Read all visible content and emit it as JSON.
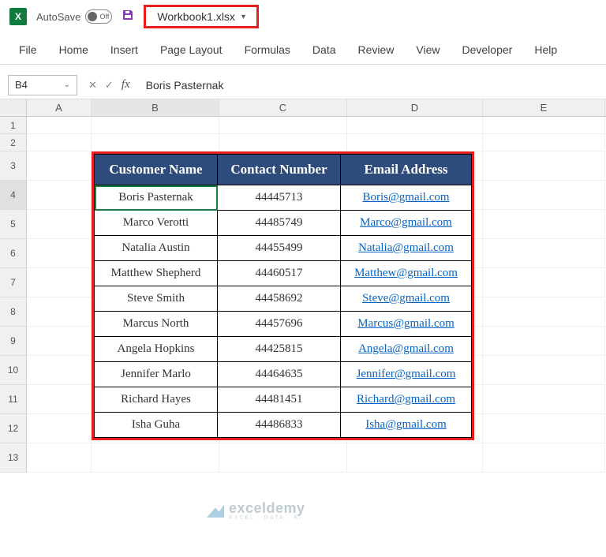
{
  "titlebar": {
    "autosave_label": "AutoSave",
    "toggle_state": "Off",
    "filename": "Workbook1.xlsx"
  },
  "ribbon": [
    "File",
    "Home",
    "Insert",
    "Page Layout",
    "Formulas",
    "Data",
    "Review",
    "View",
    "Developer",
    "Help"
  ],
  "namebox": "B4",
  "formula_value": "Boris Pasternak",
  "columns": [
    "A",
    "B",
    "C",
    "D",
    "E"
  ],
  "row_numbers": [
    1,
    2,
    3,
    4,
    5,
    6,
    7,
    8,
    9,
    10,
    11,
    12,
    13
  ],
  "table": {
    "headers": [
      "Customer Name",
      "Contact Number",
      "Email Address"
    ],
    "rows": [
      {
        "name": "Boris Pasternak",
        "contact": "44445713",
        "email": "Boris@gmail.com"
      },
      {
        "name": "Marco Verotti",
        "contact": "44485749",
        "email": "Marco@gmail.com"
      },
      {
        "name": "Natalia Austin",
        "contact": "44455499",
        "email": "Natalia@gmail.com"
      },
      {
        "name": "Matthew Shepherd",
        "contact": "44460517",
        "email": "Matthew@gmail.com"
      },
      {
        "name": "Steve Smith",
        "contact": "44458692",
        "email": "Steve@gmail.com"
      },
      {
        "name": "Marcus North",
        "contact": "44457696",
        "email": "Marcus@gmail.com"
      },
      {
        "name": "Angela Hopkins",
        "contact": "44425815",
        "email": "Angela@gmail.com"
      },
      {
        "name": "Jennifer Marlo",
        "contact": "44464635",
        "email": "Jennifer@gmail.com"
      },
      {
        "name": "Richard Hayes",
        "contact": "44481451",
        "email": "Richard@gmail.com"
      },
      {
        "name": "Isha Guha",
        "contact": "44486833",
        "email": "Isha@gmail.com"
      }
    ]
  },
  "watermark": {
    "brand": "exceldemy",
    "tag": "EXCEL · DATA · BI"
  }
}
